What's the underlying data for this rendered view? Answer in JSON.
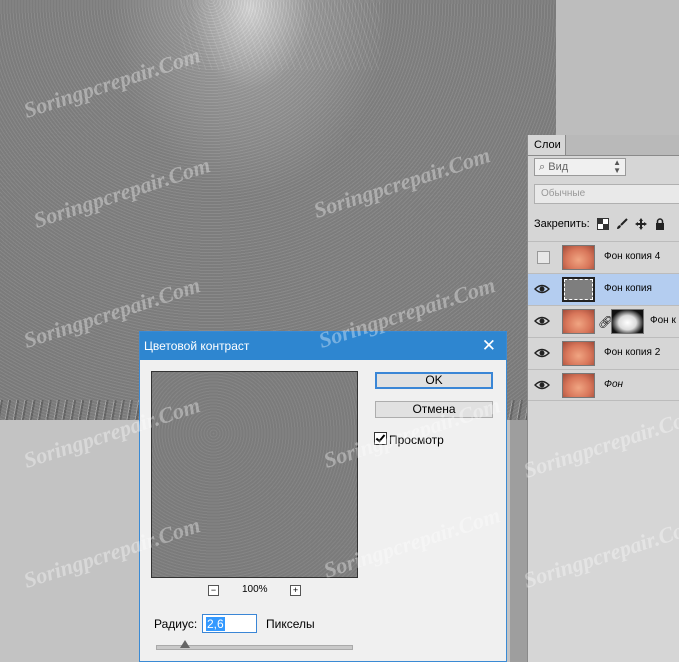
{
  "canvas": {
    "label": ""
  },
  "layers_panel": {
    "tab": "Слои",
    "filter_label": "Вид",
    "blend_mode": "Обычные",
    "lock_label": "Закрепить:",
    "layers": [
      {
        "name": "Фон копия 4",
        "visible": false,
        "thumb": "photo"
      },
      {
        "name": "Фон копия",
        "visible": true,
        "thumb": "gray",
        "selected": true
      },
      {
        "name": "Фон к",
        "visible": true,
        "thumb": "photo",
        "mask": true
      },
      {
        "name": "Фон копия 2",
        "visible": true,
        "thumb": "photo"
      },
      {
        "name": "Фон",
        "visible": true,
        "thumb": "photo",
        "italic": true
      }
    ]
  },
  "dialog": {
    "title": "Цветовой контраст",
    "ok_label": "OK",
    "cancel_label": "Отмена",
    "preview_label": "Просмотр",
    "preview_checked": true,
    "zoom_minus": "−",
    "zoom_value": "100%",
    "zoom_plus": "+",
    "radius_label": "Радиус:",
    "radius_value": "2,6",
    "radius_unit": "Пикселы"
  },
  "watermark": "Soringpcrepair.Com",
  "colors": {
    "accent": "#2e86d0",
    "selection": "#b4cdf0"
  }
}
